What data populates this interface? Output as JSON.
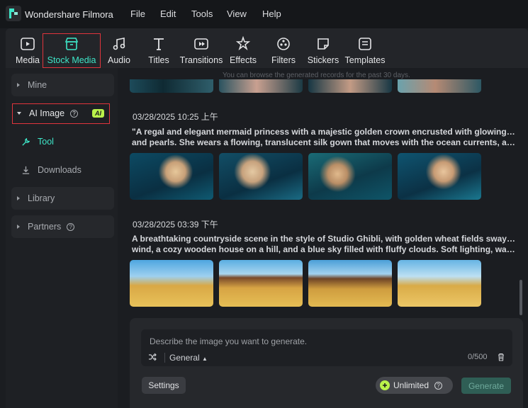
{
  "app": {
    "title": "Wondershare Filmora"
  },
  "menubar": [
    "File",
    "Edit",
    "Tools",
    "View",
    "Help"
  ],
  "toolbar": [
    {
      "label": "Media",
      "icon": "media-icon"
    },
    {
      "label": "Stock Media",
      "icon": "stock-media-icon",
      "active": true
    },
    {
      "label": "Audio",
      "icon": "audio-icon"
    },
    {
      "label": "Titles",
      "icon": "titles-icon"
    },
    {
      "label": "Transitions",
      "icon": "transitions-icon"
    },
    {
      "label": "Effects",
      "icon": "effects-icon"
    },
    {
      "label": "Filters",
      "icon": "filters-icon"
    },
    {
      "label": "Stickers",
      "icon": "stickers-icon"
    },
    {
      "label": "Templates",
      "icon": "templates-icon"
    }
  ],
  "sidebar": {
    "mine": "Mine",
    "ai_image": "AI Image",
    "ai_badge": "AI",
    "tool": "Tool",
    "downloads": "Downloads",
    "library": "Library",
    "partners": "Partners"
  },
  "main": {
    "records_note": "You can browse the generated records for the past 30 days.",
    "records": [
      {
        "date": "03/28/2025 10:25 上午",
        "prompt_line1": "\"A regal and elegant mermaid princess with a majestic golden crown encrusted with glowing sapphires",
        "prompt_line2": "and pearls. She wears a flowing, translucent silk gown that moves with the ocean currents, and her lo..."
      },
      {
        "date": "03/28/2025 03:39 下午",
        "prompt_line1": "A breathtaking countryside scene in the style of Studio Ghibli, with golden wheat fields swaying in the",
        "prompt_line2": "wind, a cozy wooden house on a hill, and a blue sky filled with fluffy clouds. Soft lighting, warm colo..."
      }
    ]
  },
  "generator": {
    "placeholder": "Describe the image you want to generate.",
    "style": "General",
    "count": "0/500",
    "settings_label": "Settings",
    "unlimited_label": "Unlimited",
    "generate_label": "Generate"
  },
  "colors": {
    "accent": "#3ee6c8",
    "highlight_box": "#e0343c",
    "ai_badge": "#b9f24a"
  }
}
